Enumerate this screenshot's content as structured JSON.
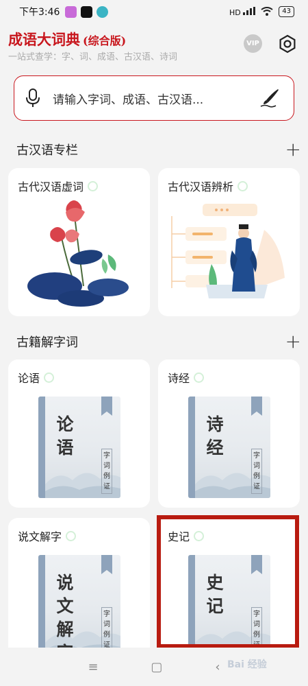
{
  "status_bar": {
    "time": "下午3:46",
    "network": "HD",
    "battery": "43"
  },
  "header": {
    "title": "成语大词典",
    "title_suffix": "(综合版)",
    "subtitle": "一站式查学：字、词、成语、古汉语、诗词",
    "vip_label": "VIP"
  },
  "search": {
    "placeholder": "请输入字词、成语、古汉语..."
  },
  "sections": [
    {
      "heading": "古汉语专栏",
      "cards": [
        {
          "title": "古代汉语虚词"
        },
        {
          "title": "古代汉语辨析"
        }
      ]
    },
    {
      "heading": "古籍解字词",
      "cards": [
        {
          "title": "论语",
          "cover_title": "论语",
          "tag": "字词例证"
        },
        {
          "title": "诗经",
          "cover_title": "诗经",
          "tag": "字词例证"
        },
        {
          "title": "说文解字",
          "cover_title": "说文解字",
          "tag": "字词例证"
        },
        {
          "title": "史记",
          "cover_title": "史记",
          "tag": "字词例证"
        }
      ]
    }
  ],
  "nav": {
    "menu": "≡",
    "home": "▢",
    "back": "‹"
  },
  "watermark": "Bai 经验",
  "colors": {
    "brand_red": "#c8161d",
    "book_spine": "#8ea3bb",
    "highlight_box": "#b81b10"
  }
}
